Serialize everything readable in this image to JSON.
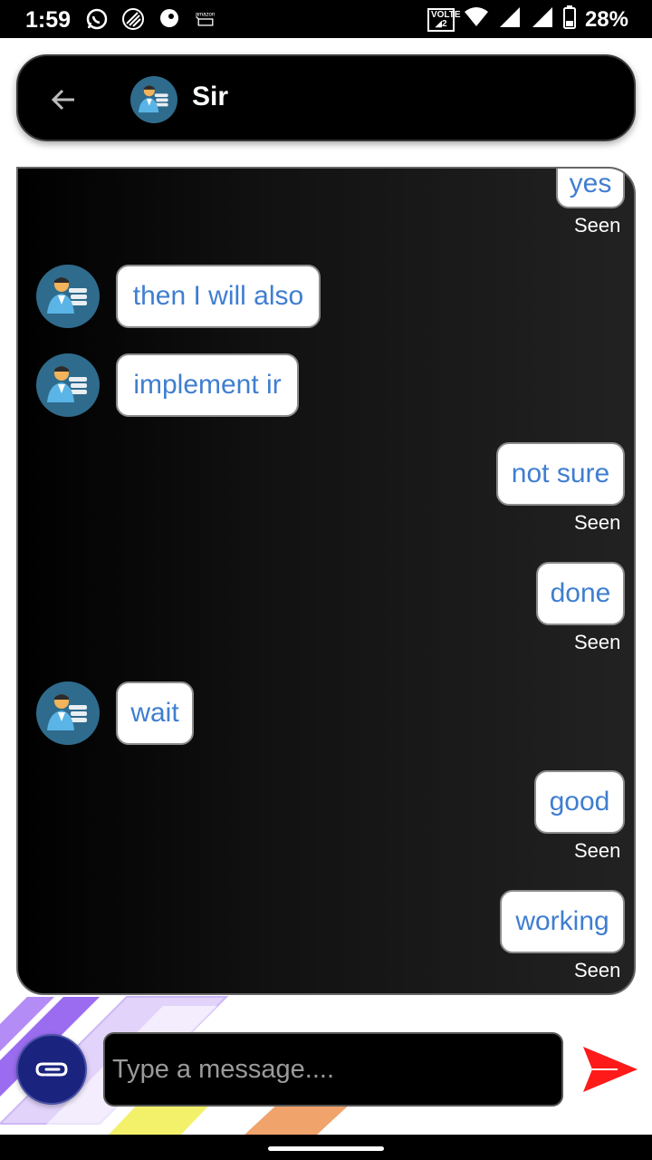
{
  "status_bar": {
    "time": "1:59",
    "volte_label": "VOLTE",
    "battery_percent": "28%",
    "icons": [
      "whatsapp-icon",
      "swirl-icon",
      "chat-bubble-icon",
      "amazon-icon",
      "wifi-icon",
      "signal-icon",
      "signal-icon",
      "battery-icon"
    ]
  },
  "header": {
    "title": "Sir",
    "back_icon": "arrow-left-icon",
    "avatar_icon": "user-avatar-icon"
  },
  "messages": [
    {
      "text": "yes",
      "direction": "outgoing",
      "status": "Seen"
    },
    {
      "text": "then I will also",
      "direction": "incoming"
    },
    {
      "text": "implement ir",
      "direction": "incoming"
    },
    {
      "text": "not sure",
      "direction": "outgoing",
      "status": "Seen"
    },
    {
      "text": "done",
      "direction": "outgoing",
      "status": "Seen"
    },
    {
      "text": "wait",
      "direction": "incoming"
    },
    {
      "text": "good",
      "direction": "outgoing",
      "status": "Seen"
    },
    {
      "text": "working",
      "direction": "outgoing",
      "status": "Seen"
    }
  ],
  "composer": {
    "placeholder": "Type a message....",
    "attach_icon": "paperclip-icon",
    "send_icon": "send-arrow-icon"
  },
  "colors": {
    "bubble_text": "#3f7ed0",
    "attach_button": "#1a237e",
    "send_arrow": "#ff1a1a"
  }
}
